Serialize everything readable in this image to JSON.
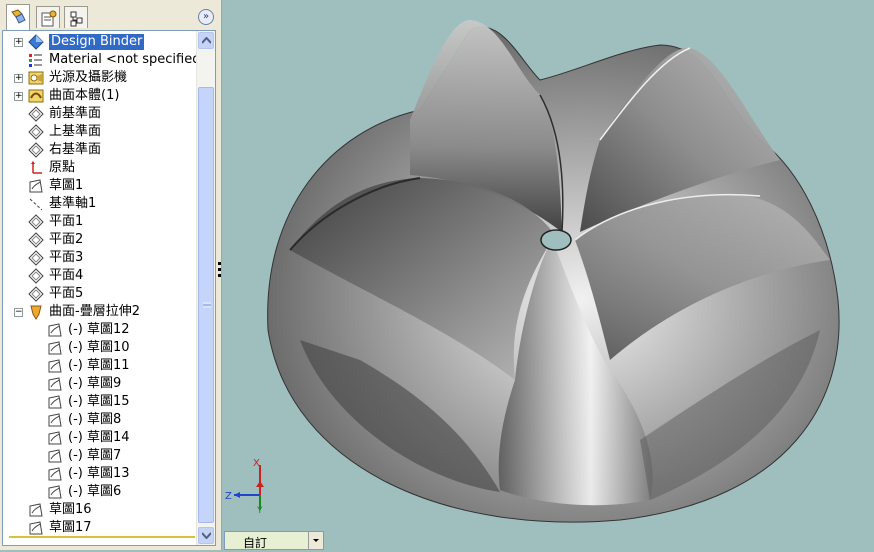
{
  "panel": {
    "tabs": [
      {
        "name": "feature-manager-tab",
        "active": true
      },
      {
        "name": "property-manager-tab",
        "active": false
      },
      {
        "name": "configuration-manager-tab",
        "active": false
      }
    ],
    "collapse_glyph": "»"
  },
  "tree": {
    "items": [
      {
        "label": "Design Binder",
        "icon": "design-binder-icon",
        "selected": true,
        "expander": "+"
      },
      {
        "label": "Material <not specified>",
        "icon": "material-icon"
      },
      {
        "label": "光源及攝影機",
        "icon": "lights-cameras-icon",
        "expander": "+"
      },
      {
        "label": "曲面本體(1)",
        "icon": "surface-bodies-icon",
        "expander": "+"
      },
      {
        "label": "前基準面",
        "icon": "plane-icon"
      },
      {
        "label": "上基準面",
        "icon": "plane-icon"
      },
      {
        "label": "右基準面",
        "icon": "plane-icon"
      },
      {
        "label": "原點",
        "icon": "origin-icon"
      },
      {
        "label": "草圖1",
        "icon": "sketch-icon"
      },
      {
        "label": "基準軸1",
        "icon": "axis-icon"
      },
      {
        "label": "平面1",
        "icon": "plane-icon"
      },
      {
        "label": "平面2",
        "icon": "plane-icon"
      },
      {
        "label": "平面3",
        "icon": "plane-icon"
      },
      {
        "label": "平面4",
        "icon": "plane-icon"
      },
      {
        "label": "平面5",
        "icon": "plane-icon"
      },
      {
        "label": "曲面-疊層拉伸2",
        "icon": "surface-loft-icon",
        "expander": "−"
      },
      {
        "label": "(-) 草圖12",
        "icon": "sketch-icon",
        "child": true
      },
      {
        "label": "(-) 草圖10",
        "icon": "sketch-icon",
        "child": true
      },
      {
        "label": "(-) 草圖11",
        "icon": "sketch-icon",
        "child": true
      },
      {
        "label": "(-) 草圖9",
        "icon": "sketch-icon",
        "child": true
      },
      {
        "label": "(-) 草圖15",
        "icon": "sketch-icon",
        "child": true
      },
      {
        "label": "(-) 草圖8",
        "icon": "sketch-icon",
        "child": true
      },
      {
        "label": "(-) 草圖14",
        "icon": "sketch-icon",
        "child": true
      },
      {
        "label": "(-) 草圖7",
        "icon": "sketch-icon",
        "child": true
      },
      {
        "label": "(-) 草圖13",
        "icon": "sketch-icon",
        "child": true
      },
      {
        "label": "(-) 草圖6",
        "icon": "sketch-icon",
        "child": true
      },
      {
        "label": "草圖16",
        "icon": "sketch-icon"
      },
      {
        "label": "草圖17",
        "icon": "sketch-icon"
      }
    ]
  },
  "viewport": {
    "background": "#9fbfbf",
    "triad": {
      "x": "X",
      "y": "Y",
      "z": "Z"
    }
  },
  "config": {
    "label": "自訂"
  }
}
